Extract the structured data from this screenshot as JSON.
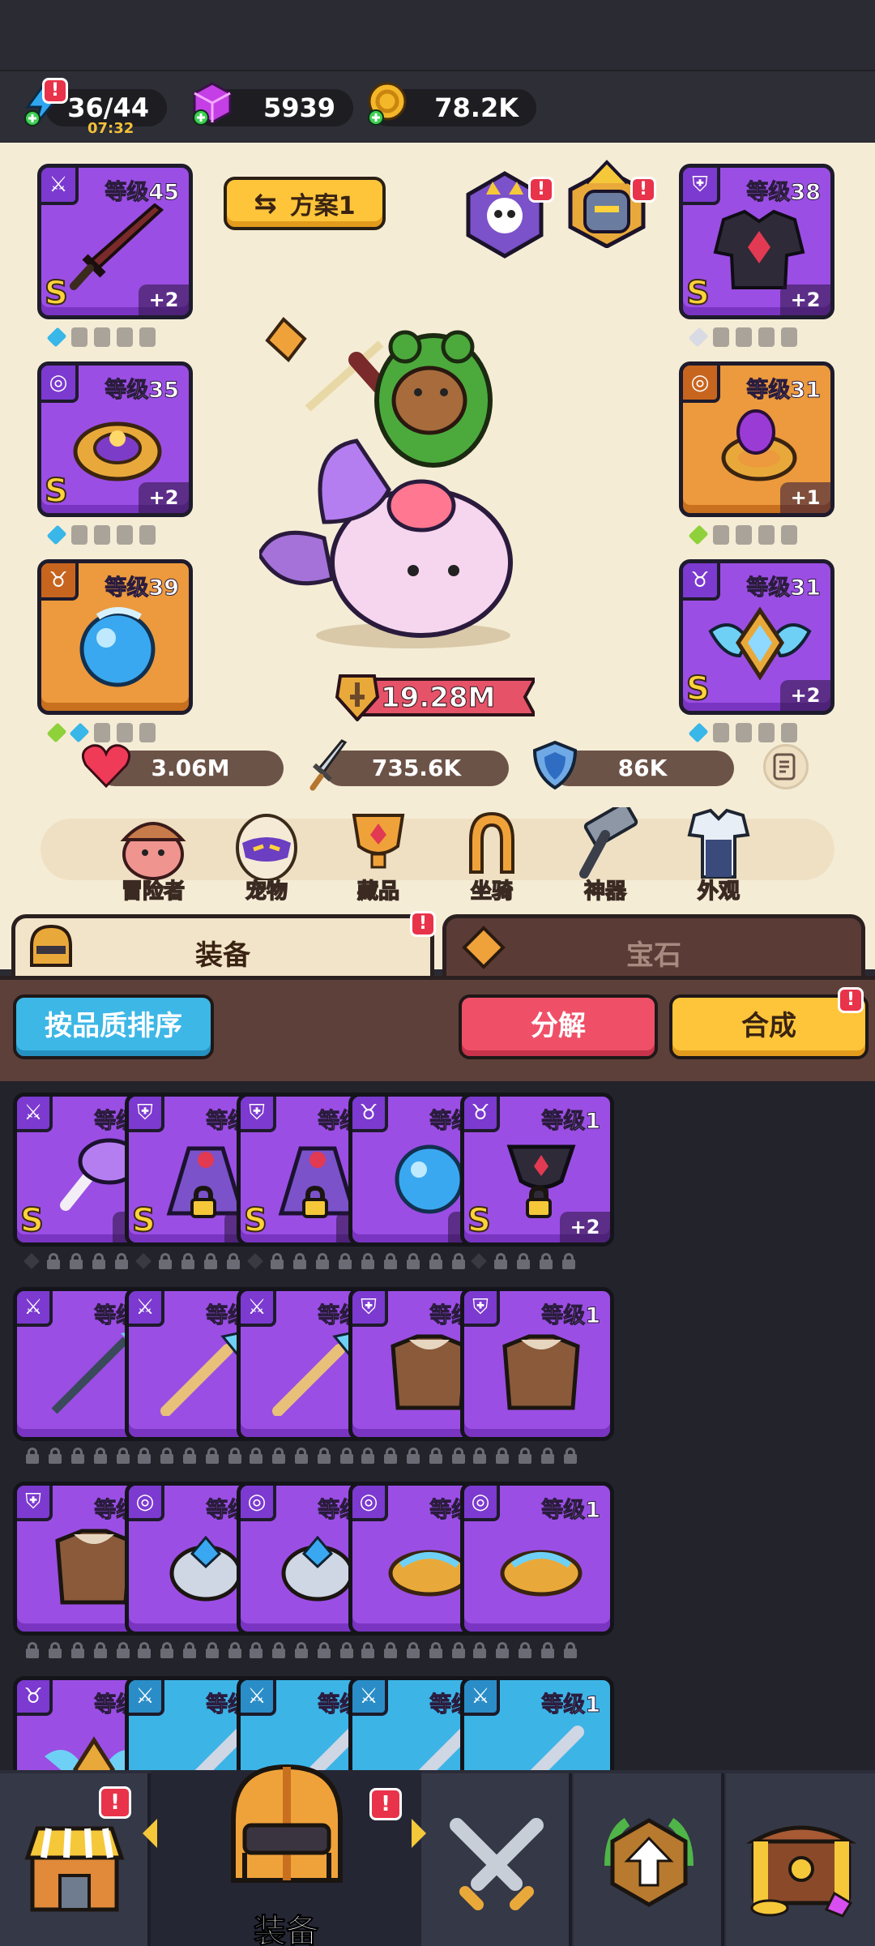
{
  "resources": {
    "energy": "36/44",
    "energy_timer": "07:32",
    "gems": "5939",
    "gold": "78.2K"
  },
  "loadout": {
    "plan_label": "方案1",
    "combat_power": "19.28M",
    "stats": {
      "hp": "3.06M",
      "attack": "735.6K",
      "defense": "86K"
    },
    "left_slots": [
      {
        "type_icon": "sword-icon",
        "level": "等级45",
        "grade": "S",
        "plus": "+2",
        "color": "purple"
      },
      {
        "type_icon": "ring-icon",
        "level": "等级35",
        "grade": "S",
        "plus": "+2",
        "color": "purple"
      },
      {
        "type_icon": "necklace-icon",
        "level": "等级39",
        "grade": "",
        "plus": "",
        "color": "orange"
      }
    ],
    "right_slots": [
      {
        "type_icon": "armor-icon",
        "level": "等级38",
        "grade": "S",
        "plus": "+2",
        "color": "purple"
      },
      {
        "type_icon": "ring-icon",
        "level": "等级31",
        "grade": "",
        "plus": "+1",
        "color": "orange"
      },
      {
        "type_icon": "necklace-icon",
        "level": "等级31",
        "grade": "S",
        "plus": "+2",
        "color": "purple"
      }
    ]
  },
  "nav": {
    "items": [
      "冒险者",
      "宠物",
      "藏品",
      "坐骑",
      "神器",
      "外观"
    ]
  },
  "tabs": {
    "equipment": "装备",
    "gems": "宝石"
  },
  "toolbar": {
    "sort": "按品质排序",
    "decompose": "分解",
    "merge": "合成"
  },
  "inventory": {
    "rows": [
      [
        {
          "type_icon": "sword-icon",
          "level": "等级1",
          "grade": "S",
          "plus": "+2",
          "color": "purple",
          "locked": false,
          "item": "mace"
        },
        {
          "type_icon": "armor-icon",
          "level": "等级1",
          "grade": "S",
          "plus": "+2",
          "color": "purple",
          "locked": true,
          "item": "cape"
        },
        {
          "type_icon": "armor-icon",
          "level": "等级1",
          "grade": "S",
          "plus": "+2",
          "color": "purple",
          "locked": true,
          "item": "cape"
        },
        {
          "type_icon": "necklace-icon",
          "level": "等级1",
          "grade": "",
          "plus": "+2",
          "color": "purple",
          "locked": false,
          "item": "orb"
        },
        {
          "type_icon": "necklace-icon",
          "level": "等级1",
          "grade": "S",
          "plus": "+2",
          "color": "purple",
          "locked": true,
          "item": "chalice"
        }
      ],
      [
        {
          "type_icon": "sword-icon",
          "level": "等级1",
          "grade": "",
          "plus": "",
          "color": "purple",
          "locked": false,
          "item": "spear"
        },
        {
          "type_icon": "sword-icon",
          "level": "等级1",
          "grade": "",
          "plus": "",
          "color": "purple",
          "locked": false,
          "item": "staff"
        },
        {
          "type_icon": "sword-icon",
          "level": "等级1",
          "grade": "",
          "plus": "",
          "color": "purple",
          "locked": false,
          "item": "staff"
        },
        {
          "type_icon": "armor-icon",
          "level": "等级1",
          "grade": "",
          "plus": "",
          "color": "purple",
          "locked": false,
          "item": "fur"
        },
        {
          "type_icon": "armor-icon",
          "level": "等级1",
          "grade": "",
          "plus": "",
          "color": "purple",
          "locked": false,
          "item": "fur"
        }
      ],
      [
        {
          "type_icon": "armor-icon",
          "level": "等级1",
          "grade": "",
          "plus": "",
          "color": "purple",
          "locked": false,
          "item": "fur"
        },
        {
          "type_icon": "ring-icon",
          "level": "等级1",
          "grade": "",
          "plus": "",
          "color": "purple",
          "locked": false,
          "item": "ring-blue"
        },
        {
          "type_icon": "ring-icon",
          "level": "等级1",
          "grade": "",
          "plus": "",
          "color": "purple",
          "locked": false,
          "item": "ring-blue"
        },
        {
          "type_icon": "ring-icon",
          "level": "等级1",
          "grade": "",
          "plus": "",
          "color": "purple",
          "locked": false,
          "item": "ring-gold"
        },
        {
          "type_icon": "ring-icon",
          "level": "等级1",
          "grade": "",
          "plus": "",
          "color": "purple",
          "locked": false,
          "item": "ring-gold"
        }
      ],
      [
        {
          "type_icon": "necklace-icon",
          "level": "等级1",
          "grade": "",
          "plus": "",
          "color": "purple",
          "locked": false,
          "item": "amulet"
        },
        {
          "type_icon": "sword-icon",
          "level": "等级1",
          "grade": "",
          "plus": "",
          "color": "blue",
          "locked": false,
          "item": "sword"
        },
        {
          "type_icon": "sword-icon",
          "level": "等级1",
          "grade": "",
          "plus": "",
          "color": "blue",
          "locked": false,
          "item": "sword"
        },
        {
          "type_icon": "sword-icon",
          "level": "等级1",
          "grade": "",
          "plus": "",
          "color": "blue",
          "locked": false,
          "item": "sword"
        },
        {
          "type_icon": "sword-icon",
          "level": "等级1",
          "grade": "",
          "plus": "",
          "color": "blue",
          "locked": false,
          "item": "sword"
        }
      ]
    ]
  },
  "bottom_nav": {
    "active_label": "装备"
  }
}
